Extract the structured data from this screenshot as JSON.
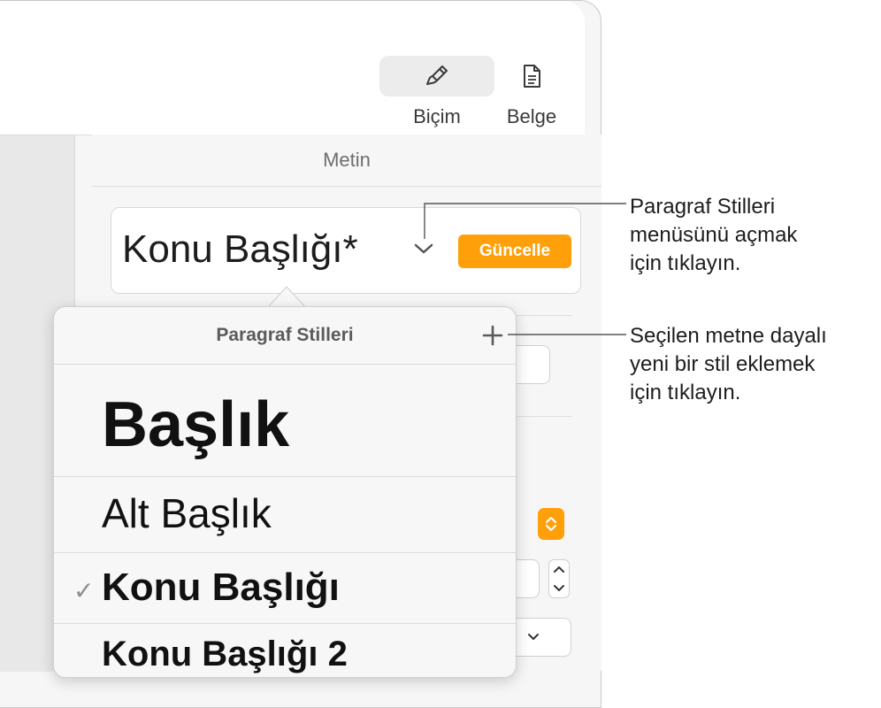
{
  "toolbar": {
    "format_label": "Biçim",
    "document_label": "Belge",
    "format_icon": "paintbrush-icon",
    "document_icon": "document-icon"
  },
  "inspector": {
    "tab_label": "Metin",
    "current_style": "Konu Başlığı*",
    "update_label": "Güncelle"
  },
  "popover": {
    "title": "Paragraf Stilleri",
    "styles": [
      {
        "label": "Başlık",
        "checked": false
      },
      {
        "label": "Alt Başlık",
        "checked": false
      },
      {
        "label": "Konu Başlığı",
        "checked": true
      },
      {
        "label": "Konu Başlığı 2",
        "checked": false
      }
    ]
  },
  "callouts": {
    "menu_callout": [
      "Paragraf Stilleri",
      "menüsünü açmak",
      "için tıklayın."
    ],
    "add_callout": [
      "Seçilen metne dayalı",
      "yeni bir stil eklemek",
      "için tıklayın."
    ]
  },
  "colors": {
    "accent": "#ff9f0a",
    "panel_bg": "#f6f6f6"
  }
}
